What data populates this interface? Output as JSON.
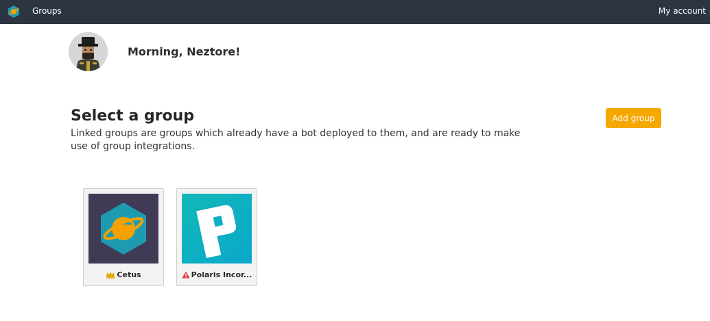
{
  "nav": {
    "logo_icon": "hexagon-planet-logo-icon",
    "groups_label": "Groups",
    "account_label": "My account",
    "bar_color": "#2c3541"
  },
  "user": {
    "greeting": "Morning, Neztore!",
    "avatar_icon": "user-avatar"
  },
  "main": {
    "heading": "Select a group",
    "description": "Linked groups are groups which already have a bot deployed to them, and are ready to make use of group integrations.",
    "add_button_label": "Add group",
    "accent_color": "#f5a800"
  },
  "groups": [
    {
      "name": "Cetus",
      "status_icon": "crown-icon",
      "status_color": "#e0a800"
    },
    {
      "name": "Polaris Incor...",
      "status_icon": "warning-icon",
      "status_color": "#e03545"
    }
  ]
}
